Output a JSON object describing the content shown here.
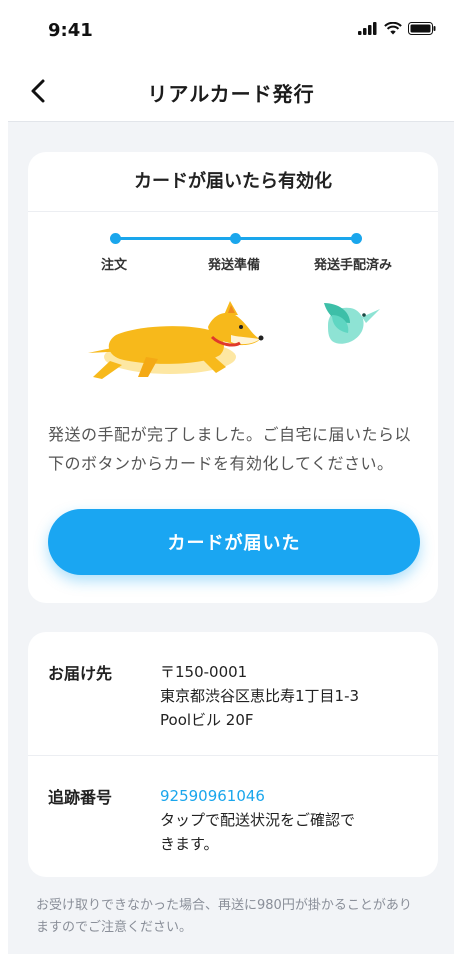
{
  "status_bar": {
    "time": "9:41"
  },
  "nav": {
    "title": "リアルカード発行"
  },
  "activation_card": {
    "title": "カードが届いたら有効化",
    "steps": [
      {
        "label": "注文"
      },
      {
        "label": "発送準備"
      },
      {
        "label": "発送手配済み"
      }
    ],
    "description": "発送の手配が完了しました。ご自宅に届いたら以下のボタンからカードを有効化してください。",
    "button_label": "カードが届いた"
  },
  "delivery": {
    "address_label": "お届け先",
    "postal_code": "〒150-0001",
    "address_line1": "東京都渋谷区恵比寿1丁目1-3",
    "address_line2": "Poolビル 20F",
    "tracking_label": "追跡番号",
    "tracking_number": "92590961046",
    "tracking_note_line1": "タップで配送状況をご確認で",
    "tracking_note_line2": "きます。"
  },
  "footer_note": "お受け取りできなかった場合、再送に980円が掛かることがありますのでご注意ください。",
  "colors": {
    "accent": "#1aa6f2",
    "background": "#f2f4f7",
    "dog": "#f7b91b",
    "bird": "#5fd6c2"
  }
}
